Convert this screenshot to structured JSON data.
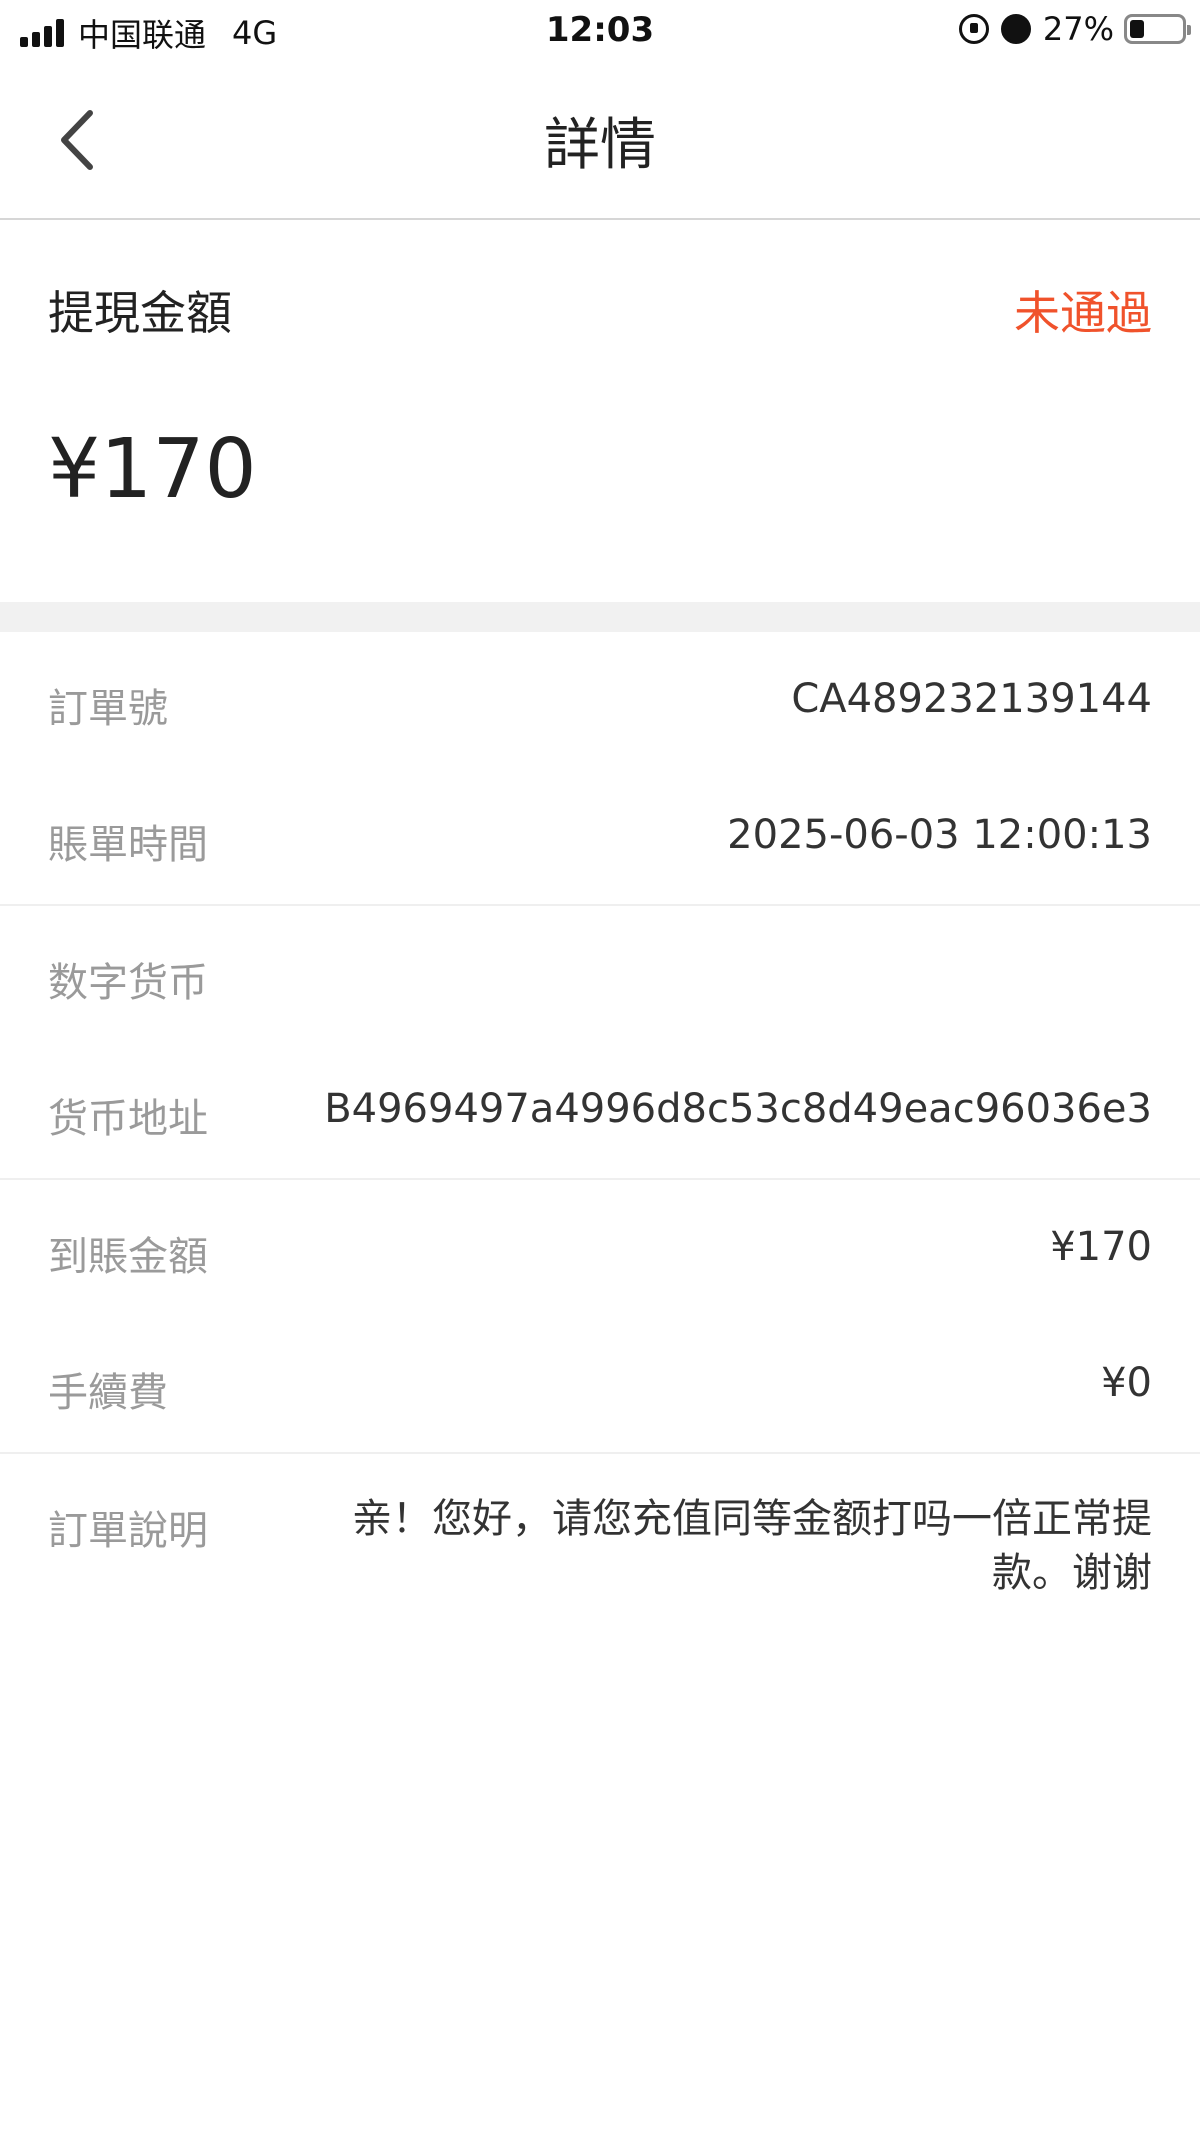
{
  "status_bar": {
    "carrier": "中国联通",
    "network": "4G",
    "time": "12:03",
    "battery": "27%",
    "battery_level": 0.27
  },
  "nav": {
    "title": "詳情",
    "back_icon": "chevron-left-icon"
  },
  "withdrawal": {
    "label": "提現金額",
    "status": "未通過",
    "status_color": "#f0522b",
    "amount": "¥170"
  },
  "details": {
    "order_no": {
      "label": "訂單號",
      "value": "CA489232139144"
    },
    "bill_time": {
      "label": "賬單時間",
      "value": "2025-06-03 12:00:13"
    },
    "currency": {
      "label": "数字货币",
      "value": ""
    },
    "address": {
      "label": "货币地址",
      "value": "B4969497a4996d8c53c8d49eac96036e3"
    },
    "received": {
      "label": "到賬金額",
      "value": "¥170"
    },
    "fee": {
      "label": "手續費",
      "value": "¥0"
    },
    "note": {
      "label": "訂單說明",
      "value": "亲！您好，请您充值同等金额打吗一倍正常提款。谢谢"
    }
  }
}
